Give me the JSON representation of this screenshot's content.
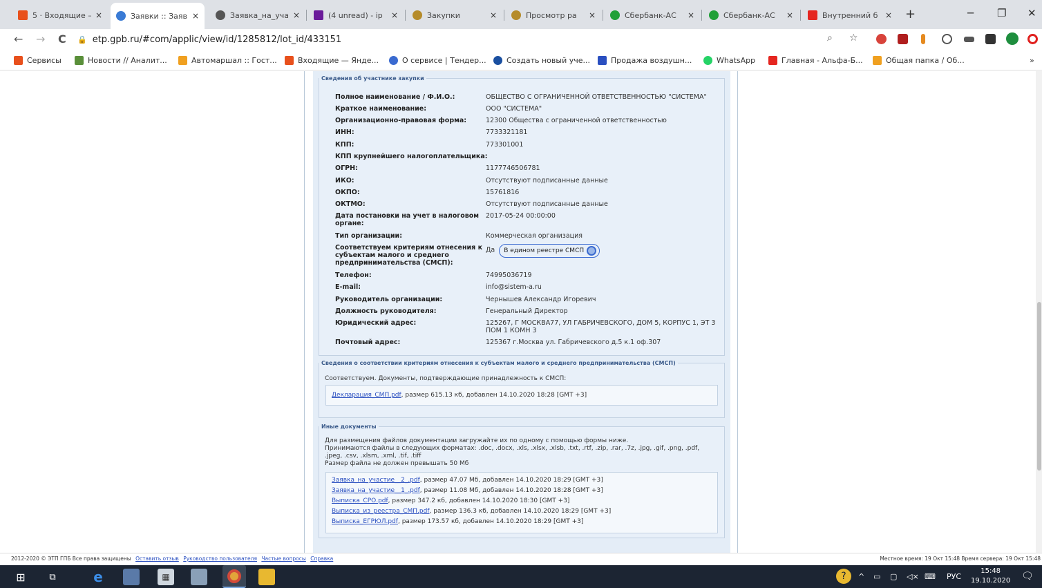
{
  "tabs": [
    {
      "title": "5 · Входящие — ",
      "active": false
    },
    {
      "title": "Заявки :: Заяв",
      "active": true
    },
    {
      "title": "Заявка_на_уча",
      "active": false
    },
    {
      "title": "(4 unread) - ip",
      "active": false
    },
    {
      "title": "Закупки",
      "active": false
    },
    {
      "title": "Просмотр ра",
      "active": false
    },
    {
      "title": "Сбербанк-АС",
      "active": false
    },
    {
      "title": "Сбербанк-АС",
      "active": false
    },
    {
      "title": "Внутренний б",
      "active": false
    }
  ],
  "tab_close": "×",
  "new_tab": "+",
  "window": {
    "minimize": "─",
    "maximize": "❐",
    "close": "✕"
  },
  "nav": {
    "back": "←",
    "forward": "→",
    "reload": "C",
    "url": "etp.gpb.ru/#com/applic/view/id/1285812/lot_id/433151"
  },
  "bookmarks": [
    {
      "label": "Сервисы"
    },
    {
      "label": "Новости // Аналит..."
    },
    {
      "label": "Автомаршал :: Гост..."
    },
    {
      "label": "Входящие — Янде..."
    },
    {
      "label": "О сервисе | Тендер..."
    },
    {
      "label": "Создать новый уче..."
    },
    {
      "label": "Продажа воздушн..."
    },
    {
      "label": "WhatsApp"
    },
    {
      "label": "Главная - Альфа-Б..."
    },
    {
      "label": "Общая папка / Об..."
    }
  ],
  "bookmarks_more": "»",
  "participant": {
    "legend": "Сведения об участнике закупки",
    "rows": [
      {
        "k": "Полное наименование / Ф.И.О.:",
        "v": "ОБЩЕСТВО С ОГРАНИЧЕННОЙ ОТВЕТСТВЕННОСТЬЮ \"СИСТЕМА\""
      },
      {
        "k": "Краткое наименование:",
        "v": "ООО \"СИСТЕМА\""
      },
      {
        "k": "Организационно-правовая форма:",
        "v": "12300 Общества с ограниченной ответственностью"
      },
      {
        "k": "ИНН:",
        "v": "7733321181"
      },
      {
        "k": "КПП:",
        "v": "773301001"
      },
      {
        "k": "КПП крупнейшего налогоплательщика:",
        "v": ""
      },
      {
        "k": "ОГРН:",
        "v": "1177746506781"
      },
      {
        "k": "ИКО:",
        "v": "Отсутствуют подписанные данные"
      },
      {
        "k": "ОКПО:",
        "v": "15761816"
      },
      {
        "k": "ОКТМО:",
        "v": "Отсутствуют подписанные данные"
      },
      {
        "k": "Дата постановки на учет в налоговом органе:",
        "v": "2017-05-24 00:00:00"
      },
      {
        "k": "Тип организации:",
        "v": "Коммерческая организация"
      },
      {
        "k": "Соответствуем критериям отнесения к субъектам малого и среднего предпринимательства (СМСП):",
        "v": "Да"
      },
      {
        "k": "Телефон:",
        "v": "74995036719"
      },
      {
        "k": "E-mail:",
        "v": "info@sistem-a.ru"
      },
      {
        "k": "Руководитель организации:",
        "v": "Чернышев Александр Игоревич"
      },
      {
        "k": "Должность руководителя:",
        "v": "Генеральный Директор"
      },
      {
        "k": "Юридический адрес:",
        "v": "125267, Г МОСКВА77, УЛ ГАБРИЧЕВСКОГО, ДОМ 5, КОРПУС 1, ЭТ 3 ПОМ 1 КОМН 3"
      },
      {
        "k": "Почтовый адрес:",
        "v": "125367 г.Москва ул. Габричевского д.5 к.1 оф.307"
      }
    ],
    "smsp_badge": "В едином реестре СМСП"
  },
  "smsp": {
    "legend": "Сведения о соответствии критериям отнесения к субъектам малого и среднего предпринимательства (СМСП)",
    "text": "Соответствуем. Документы, подтверждающие принадлежность к СМСП:",
    "file": {
      "name": "Декларация_СМП.pdf",
      "meta": ", размер 615.13 кб, добавлен 14.10.2020 18:28 [GMT +3]"
    }
  },
  "other_docs": {
    "legend": "Иные документы",
    "text1": "Для размещения файлов документации загружайте их по одному с помощью формы ниже.",
    "text2": "Принимаются файлы в следующих форматах: .doc, .docx, .xls, .xlsx, .xlsb, .txt, .rtf, .zip, .rar, .7z, .jpg, .gif, .png, .pdf, .jpeg, .csv, .xlsm, .xml, .tif, .tiff",
    "text3": "Размер файла не должен превышать 50 Мб",
    "files": [
      {
        "name": "Заявка_на_участие__2_.pdf",
        "meta": ", размер 47.07 Мб, добавлен 14.10.2020 18:29 [GMT +3]"
      },
      {
        "name": "Заявка_на_участие__1_.pdf",
        "meta": ", размер 11.08 Мб, добавлен 14.10.2020 18:28 [GMT +3]"
      },
      {
        "name": "Выписка_СРО.pdf",
        "meta": ", размер 347.2 кб, добавлен 14.10.2020 18:30 [GMT +3]"
      },
      {
        "name": "Выписка_из_реестра_СМП.pdf",
        "meta": ", размер 136.3 кб, добавлен 14.10.2020 18:29 [GMT +3]"
      },
      {
        "name": "Выписка_ЕГРЮЛ.pdf",
        "meta": ", размер 173.57 кб, добавлен 14.10.2020 18:29 [GMT +3]"
      }
    ]
  },
  "status": {
    "copyright": "2012-2020 © ЭТП ГПБ Все права защищены",
    "links": [
      "Оставить отзыв",
      "Руководство пользователя",
      "Частые вопросы",
      "Справка"
    ],
    "time": "Местное время: 19 Окт 15:48 Время сервера: 19 Окт 15:48"
  },
  "taskbar": {
    "lang": "РУС",
    "time": "15:48",
    "date": "19.10.2020"
  },
  "colors": {
    "link": "#2a4fc0",
    "legend": "#3a5a8a",
    "panel": "#e8f0f9",
    "taskbar": "#1c2533"
  }
}
